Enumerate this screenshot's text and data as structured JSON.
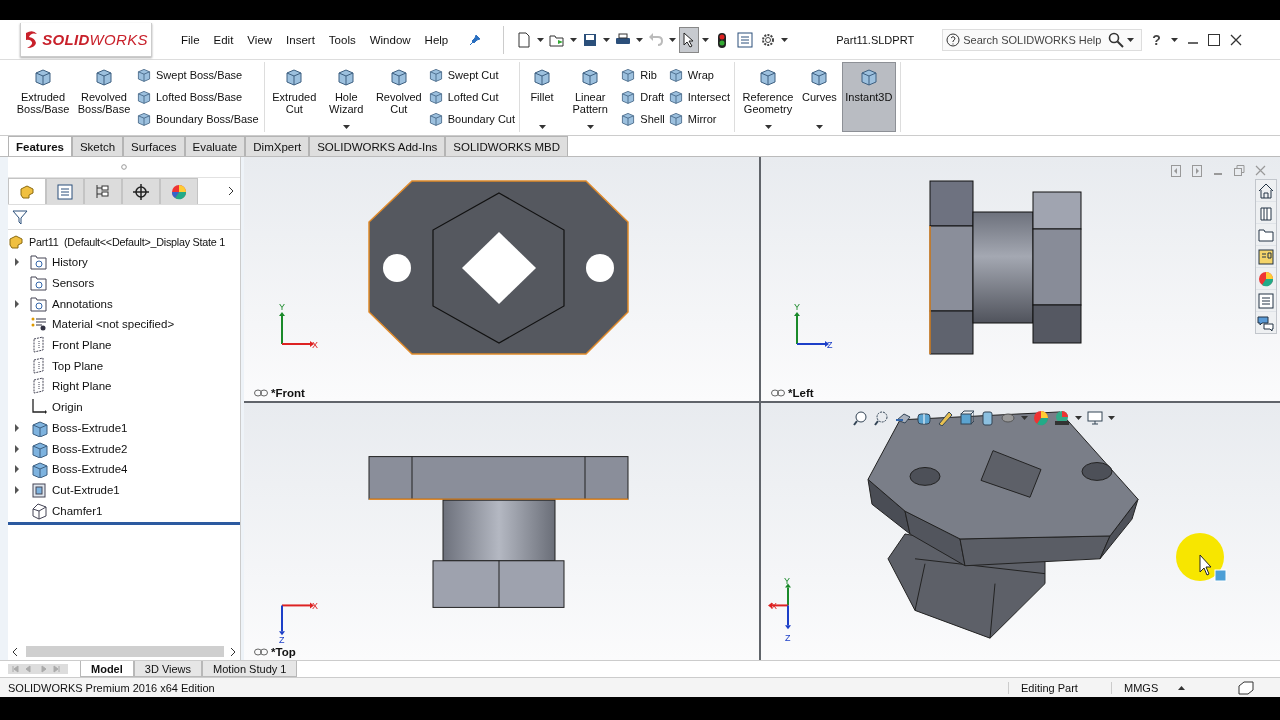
{
  "app": {
    "logo": "**SOLID**WORKS",
    "file_title": "Part11.SLDPRT"
  },
  "menu": [
    "File",
    "Edit",
    "View",
    "Insert",
    "Tools",
    "Window",
    "Help"
  ],
  "select_tool": {
    "selected": true
  },
  "search": {
    "placeholder": "Search SOLIDWORKS Help"
  },
  "help_button": "?",
  "ribbon": {
    "groups": [
      {
        "items": [
          {
            "kind": "large",
            "label": "Extruded Boss/Base",
            "dropdown": false
          },
          {
            "kind": "large",
            "label": "Revolved Boss/Base",
            "dropdown": false
          },
          {
            "kind": "stack",
            "items": [
              "Swept Boss/Base",
              "Lofted Boss/Base",
              "Boundary Boss/Base"
            ]
          }
        ]
      },
      {
        "items": [
          {
            "kind": "large",
            "label": "Extruded Cut",
            "dropdown": false
          },
          {
            "kind": "large",
            "label": "Hole Wizard",
            "dropdown": true
          },
          {
            "kind": "large",
            "label": "Revolved Cut",
            "dropdown": false
          },
          {
            "kind": "stack",
            "items": [
              "Swept Cut",
              "Lofted Cut",
              "Boundary Cut"
            ]
          }
        ]
      },
      {
        "items": [
          {
            "kind": "large",
            "label": "Fillet",
            "dropdown": true
          },
          {
            "kind": "large",
            "label": "Linear Pattern",
            "dropdown": true
          },
          {
            "kind": "stack",
            "items": [
              "Rib",
              "Draft",
              "Shell"
            ]
          },
          {
            "kind": "stack",
            "items": [
              "Wrap",
              "Intersect",
              "Mirror"
            ]
          }
        ]
      },
      {
        "items": [
          {
            "kind": "large",
            "label": "Reference Geometry",
            "dropdown": true
          },
          {
            "kind": "large",
            "label": "Curves",
            "dropdown": true
          },
          {
            "kind": "large",
            "label": "Instant3D",
            "dropdown": false,
            "selected": true
          }
        ]
      }
    ]
  },
  "command_tabs": [
    {
      "label": "Features",
      "selected": true
    },
    {
      "label": "Sketch",
      "selected": false
    },
    {
      "label": "Surfaces",
      "selected": false
    },
    {
      "label": "Evaluate",
      "selected": false
    },
    {
      "label": "DimXpert",
      "selected": false
    },
    {
      "label": "SOLIDWORKS Add-Ins",
      "selected": false
    },
    {
      "label": "SOLIDWORKS MBD",
      "selected": false
    }
  ],
  "feature_tree": {
    "root": "Part11  (Default<<Default>_Display State 1",
    "items": [
      {
        "label": "History",
        "kind": "folder",
        "expandable": true
      },
      {
        "label": "Sensors",
        "kind": "folder",
        "expandable": false
      },
      {
        "label": "Annotations",
        "kind": "folder",
        "expandable": true
      },
      {
        "label": "Material <not specified>",
        "kind": "material",
        "expandable": false
      },
      {
        "label": "Front Plane",
        "kind": "plane",
        "expandable": false
      },
      {
        "label": "Top Plane",
        "kind": "plane",
        "expandable": false
      },
      {
        "label": "Right Plane",
        "kind": "plane",
        "expandable": false
      },
      {
        "label": "Origin",
        "kind": "origin",
        "expandable": false
      },
      {
        "label": "Boss-Extrude1",
        "kind": "boss",
        "expandable": true
      },
      {
        "label": "Boss-Extrude2",
        "kind": "boss",
        "expandable": true
      },
      {
        "label": "Boss-Extrude4",
        "kind": "boss",
        "expandable": true
      },
      {
        "label": "Cut-Extrude1",
        "kind": "cut",
        "expandable": true
      },
      {
        "label": "Chamfer1",
        "kind": "chamfer",
        "expandable": false
      }
    ]
  },
  "viewports": [
    {
      "kind": "front",
      "label": "*Front",
      "axes": [
        "Y",
        "X"
      ]
    },
    {
      "kind": "left",
      "label": "*Left",
      "axes": [
        "Y",
        "Z"
      ]
    },
    {
      "kind": "top",
      "label": "*Top",
      "axes": [
        "X",
        "Z"
      ]
    },
    {
      "kind": "iso",
      "axes": [
        "Y",
        "X",
        "Z"
      ]
    }
  ],
  "bottom_tabs": [
    {
      "label": "Model",
      "selected": true
    },
    {
      "label": "3D Views",
      "selected": false
    },
    {
      "label": "Motion Study 1",
      "selected": false
    }
  ],
  "status_bar": {
    "edition": "SOLIDWORKS Premium 2016 x64 Edition",
    "mode": "Editing Part",
    "units": "MMGS"
  }
}
